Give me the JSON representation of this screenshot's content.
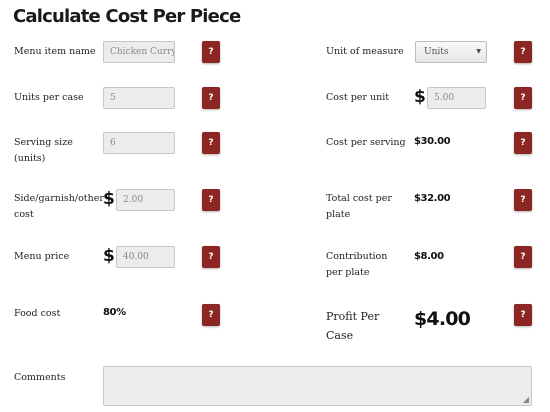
{
  "title": "Calculate Cost Per Piece",
  "help_label": "?",
  "currency_symbol": "$",
  "left": {
    "menu_item_name": {
      "label": "Menu item name",
      "value": "Chicken Curry"
    },
    "units_per_case": {
      "label": "Units per case",
      "value": "5"
    },
    "serving_size": {
      "label": "Serving size (units)",
      "value": "6"
    },
    "side_cost": {
      "label": "Side/garnish/other cost",
      "value": "2.00"
    },
    "menu_price": {
      "label": "Menu price",
      "value": "40.00"
    },
    "food_cost": {
      "label": "Food cost",
      "value": "80%"
    }
  },
  "right": {
    "unit_of_measure": {
      "label": "Unit of measure",
      "value": "Units",
      "options": [
        "Units"
      ]
    },
    "cost_per_unit": {
      "label": "Cost per unit",
      "value": "5.00"
    },
    "cost_per_serving": {
      "label": "Cost per serving",
      "value": "$30.00"
    },
    "total_cost_per_plate": {
      "label": "Total cost per plate",
      "value": "$32.00"
    },
    "contribution_per_plate": {
      "label": "Contribution per plate",
      "value": "$8.00"
    },
    "profit_per_case": {
      "label": "Profit Per Case",
      "value": "$4.00"
    }
  },
  "comments": {
    "label": "Comments",
    "value": ""
  },
  "colors": {
    "help_button": "#8b2622",
    "input_bg": "#ececec",
    "text": "#222222"
  }
}
